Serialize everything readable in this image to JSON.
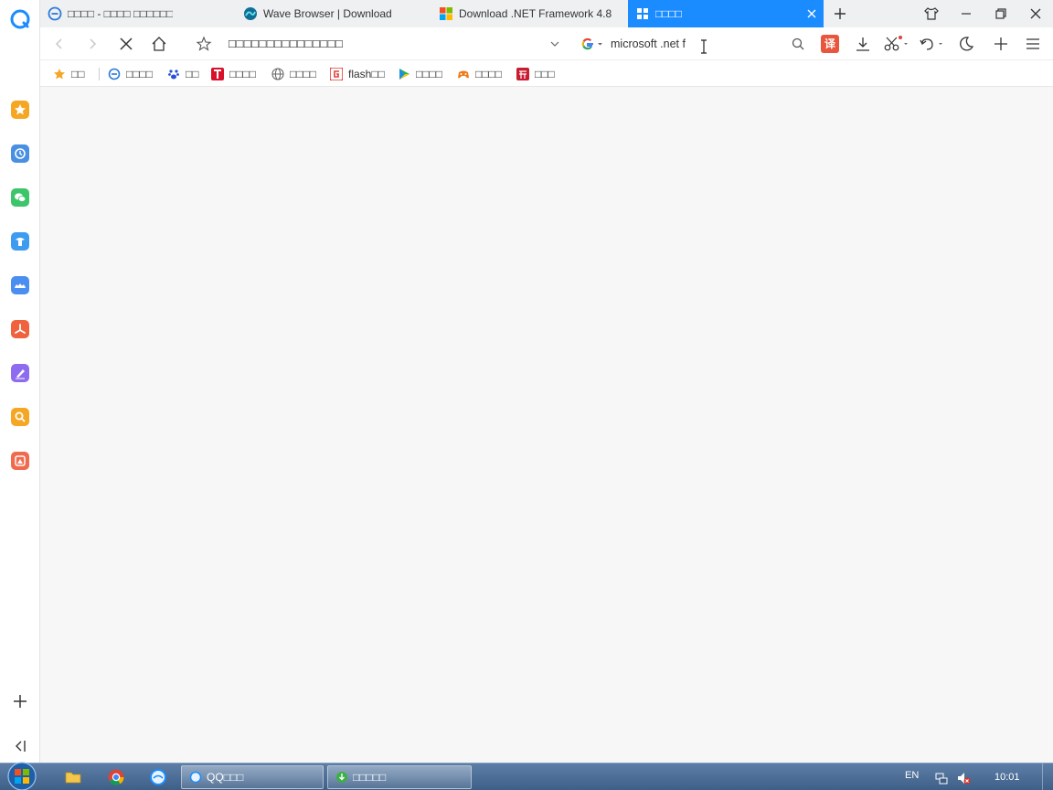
{
  "browser": {
    "tabs": [
      {
        "label": "□□□□ - □□□□ □□□□□□",
        "icon": "ie-icon",
        "active": false
      },
      {
        "label": "Wave Browser | Download",
        "icon": "wave-icon",
        "active": false
      },
      {
        "label": "Download .NET Framework 4.8",
        "icon": "windows-logo-icon",
        "active": false
      },
      {
        "label": "□□□□",
        "icon": "grid-icon",
        "active": true
      }
    ],
    "address": "□□□□□□□□□□□□□□□",
    "search": {
      "engine": "google-icon",
      "value": "microsoft .net f"
    },
    "translate_label": "译"
  },
  "bookmarks": [
    {
      "label": "□□",
      "icon": "star-icon"
    },
    {
      "label": "□□□□",
      "icon": "ie-icon"
    },
    {
      "label": "□□",
      "icon": "paw-icon"
    },
    {
      "label": "□□□□",
      "icon": "tmall-icon"
    },
    {
      "label": "□□□□",
      "icon": "globe-icon"
    },
    {
      "label": "flash□□",
      "icon": "flash-icon"
    },
    {
      "label": "□□□□",
      "icon": "play-icon"
    },
    {
      "label": "□□□□",
      "icon": "game-icon"
    },
    {
      "label": "□□□",
      "icon": "taobao-icon"
    }
  ],
  "sidebar": {
    "items": [
      {
        "name": "favorites",
        "color": "#f5a623"
      },
      {
        "name": "history",
        "color": "#4a90e2"
      },
      {
        "name": "wechat",
        "color": "#3cc56a"
      },
      {
        "name": "tools",
        "color": "#3d9cf0"
      },
      {
        "name": "cloud",
        "color": "#4a8ff0"
      },
      {
        "name": "pdf",
        "color": "#f0623d"
      },
      {
        "name": "notes",
        "color": "#8e6cf0"
      },
      {
        "name": "search",
        "color": "#f5a623"
      },
      {
        "name": "images",
        "color": "#f06a4d"
      }
    ]
  },
  "taskbar": {
    "tasks": [
      {
        "label": "QQ□□□",
        "icon": "qq-browser-icon"
      },
      {
        "label": "□□□□□",
        "icon": "download-icon"
      }
    ],
    "lang": "EN",
    "time": "10:01"
  },
  "colors": {
    "accent": "#1a8cff",
    "content_bg": "#f7f7f7"
  }
}
